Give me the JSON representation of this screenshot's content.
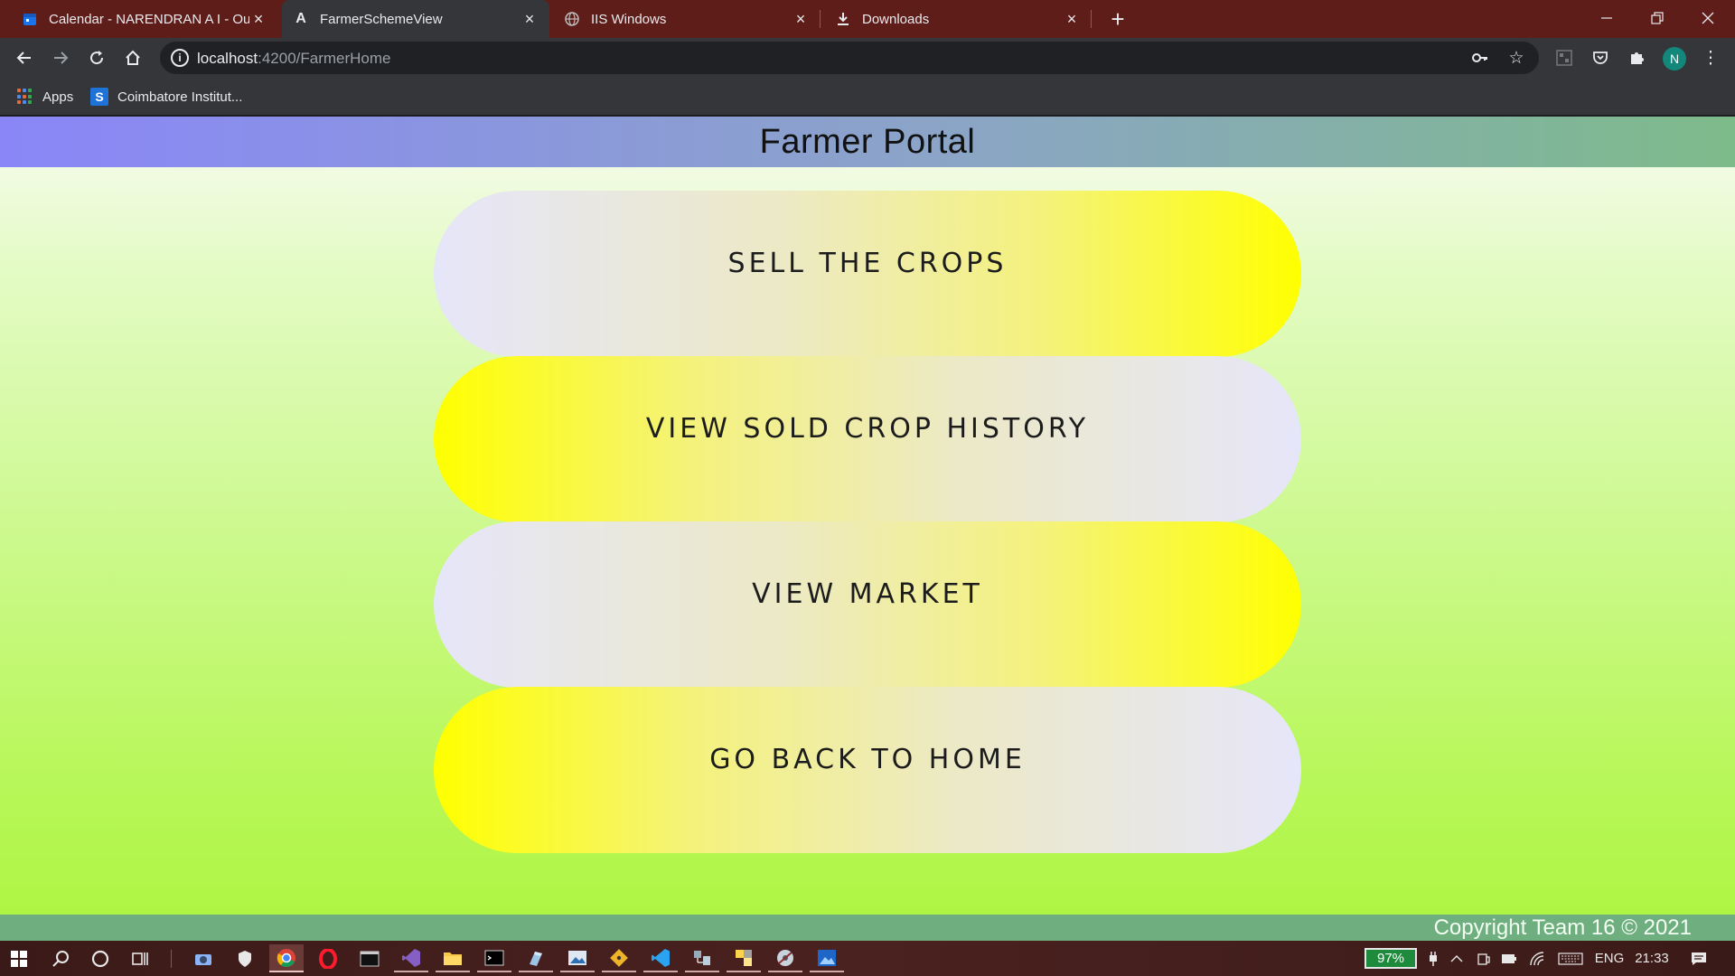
{
  "browser": {
    "tabs": [
      {
        "title": "Calendar - NARENDRAN A I - Ou",
        "icon": "calendar-icon",
        "active": false
      },
      {
        "title": "FarmerSchemeView",
        "icon": "angular-icon",
        "active": true
      },
      {
        "title": "IIS Windows",
        "icon": "globe-icon",
        "active": false
      },
      {
        "title": "Downloads",
        "icon": "download-icon",
        "active": false
      }
    ],
    "url_host": "localhost",
    "url_path": ":4200/FarmerHome",
    "profile_initial": "N",
    "bookmarks": [
      {
        "label": "Apps",
        "icon": "apps-grid-icon"
      },
      {
        "label": "Coimbatore Institut...",
        "icon": "s-logo-icon"
      }
    ]
  },
  "page": {
    "title": "Farmer Portal",
    "menu": [
      {
        "label": "SELL THE CROPS"
      },
      {
        "label": "VIEW SOLD CROP HISTORY"
      },
      {
        "label": "VIEW MARKET"
      },
      {
        "label": "GO BACK TO HOME"
      }
    ],
    "footer": "Copyright Team 16 © 2021"
  },
  "colors": {
    "header_gradient": [
      "#8a86f8",
      "#7dbb8a"
    ],
    "pill_yellow": "#ffff00",
    "pill_lavender": "#e6e6fa",
    "footer_bg": "#6fae7e"
  },
  "taskbar": {
    "battery": "97%",
    "language": "ENG",
    "time": "21:33"
  }
}
